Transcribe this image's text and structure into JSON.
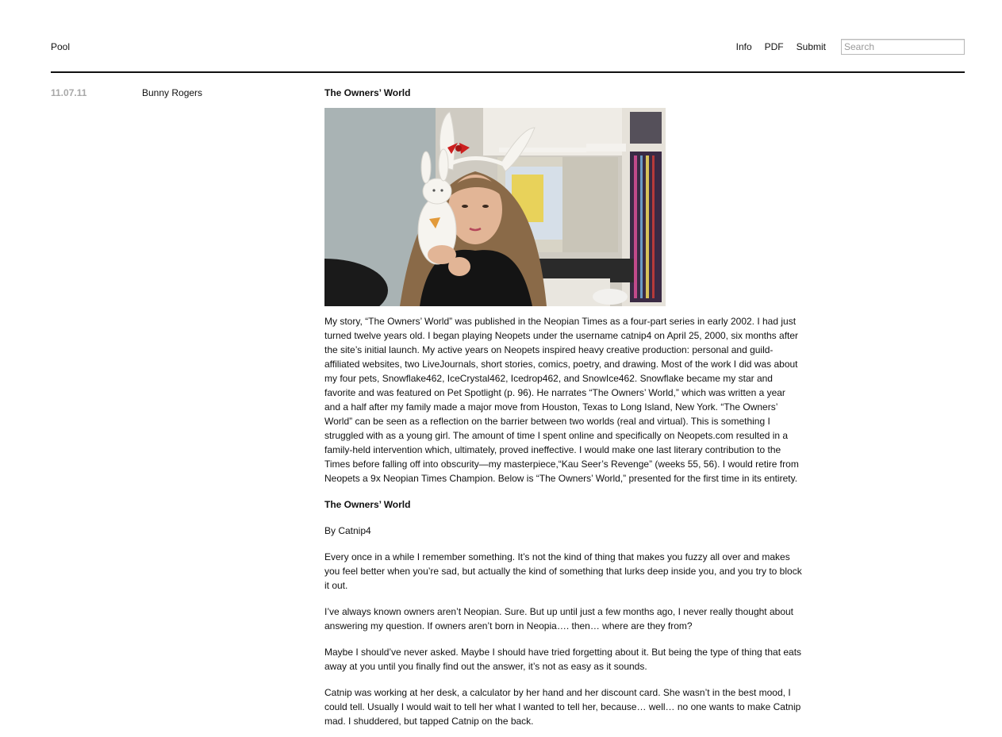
{
  "header": {
    "site_title": "Pool",
    "nav": {
      "info": "Info",
      "pdf": "PDF",
      "submit": "Submit"
    },
    "search": {
      "placeholder": "Search",
      "value": ""
    }
  },
  "post": {
    "date": "11.07.11",
    "author": "Bunny Rogers",
    "title": "The Owners’ World",
    "image": {
      "description": "Photo of a girl wearing white bunny ears holding a white toy rabbit, in front of a computer desk with CD shelves",
      "colors": {
        "wall": "#cfcbc2",
        "hair": "#8a6a48",
        "skin": "#e2b596",
        "shirt": "#141414",
        "monitor": "#d8d4c6",
        "shelf": "#e6e2da",
        "cds": "#3a2a44"
      }
    },
    "intro_paragraph": "My story, “The Owners’ World” was published in the Neopian Times as a four-part series in early 2002.  I had just turned twelve years old.  I began playing Neopets under the username catnip4 on April 25, 2000, six months after the site’s initial launch.  My active years on Neopets inspired heavy creative production: personal and guild-affiliated websites, two LiveJournals, short stories, comics, poetry, and drawing.  Most of the work I did was about my four pets, Snowflake462, IceCrystal462, Icedrop462, and SnowIce462.  Snowflake became my star and favorite and was featured on Pet Spotlight (p. 96).  He narrates “The Owners’ World,” which was written a year and a half after my family made a major move from Houston, Texas to Long Island, New York.  “The Owners’ World” can be seen as a reflection on the barrier between two worlds (real and virtual).  This is something I struggled with as a young girl.  The amount of time I spent online and specifically on Neopets.com resulted in a family-held intervention which, ultimately, proved ineffective.  I would make one last literary contribution to the Times before falling off into obscurity—my masterpiece,“Kau Seer’s Revenge” (weeks 55, 56).  I would retire from Neopets a 9x Neopian Times Champion.  Below is “The Owners’ World,” presented for the first time in its entirety.",
    "story_title": "The Owners’ World",
    "byline": "By Catnip4",
    "story_paragraphs": [
      "Every once in a while I remember something. It’s not the kind of thing that makes you fuzzy all over and makes you feel better when you’re sad, but actually the kind of something that lurks deep inside you, and you try to block it out.",
      "I’ve always known owners aren’t Neopian. Sure. But up until just a few months ago, I never really thought about answering my question. If owners aren’t born in Neopia…. then… where are they from?",
      "Maybe I should’ve never asked. Maybe I should have tried forgetting about it. But being the type of thing that eats away at you until you finally find out the answer, it’s not as easy as it sounds.",
      "Catnip was working at her desk, a calculator by her hand and her discount card. She wasn’t in the best mood, I could tell. Usually I would wait to tell her what I wanted to tell her, because… well… no one wants to make Catnip mad. I shuddered, but tapped Catnip on the back."
    ]
  }
}
